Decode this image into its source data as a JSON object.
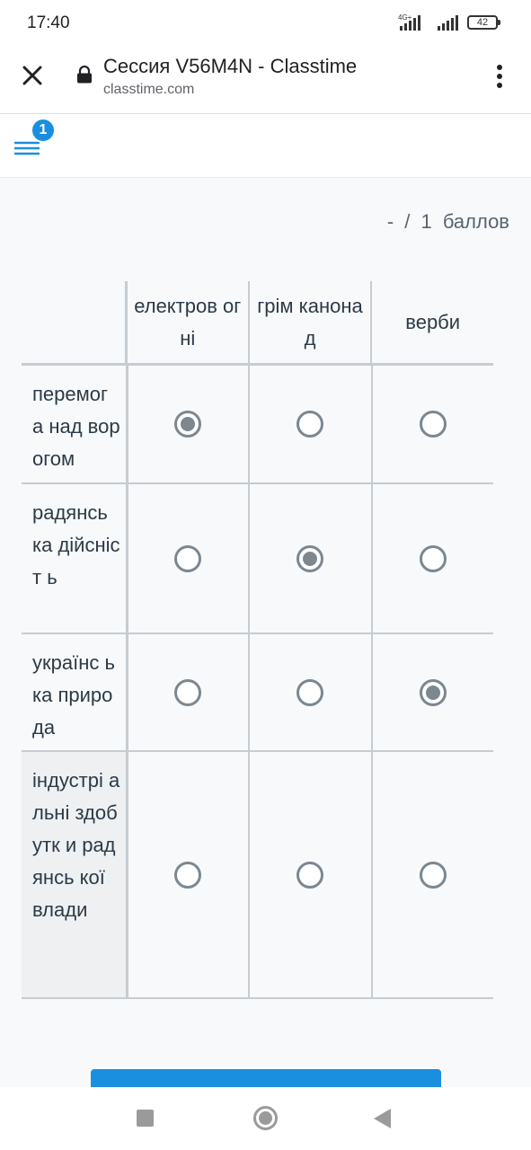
{
  "status_bar": {
    "time": "17:40",
    "network": "4G+",
    "battery": "42"
  },
  "browser": {
    "title": "Сессия V56M4N - Classtime",
    "url": "classtime.com"
  },
  "app_header": {
    "notification_count": "1"
  },
  "question": {
    "score": "- / 1 баллов",
    "columns": [
      "електров огні",
      "грім канонад",
      "верби"
    ],
    "rows": [
      {
        "label": "перемог а над ворогом",
        "selected": 0
      },
      {
        "label": "радянсь ка дійсніст ь",
        "selected": 1
      },
      {
        "label": "українс ька природа",
        "selected": 2
      },
      {
        "label": "індустрі альні здобутк и радянсь кої влади",
        "selected": null
      }
    ]
  },
  "colors": {
    "accent": "#1a8fdf",
    "radio": "#7c8790",
    "grid": "#c5ccd2"
  },
  "icons": {
    "close": "close-icon",
    "lock": "lock-icon",
    "more": "more-vert-icon",
    "menu": "menu-icon"
  }
}
